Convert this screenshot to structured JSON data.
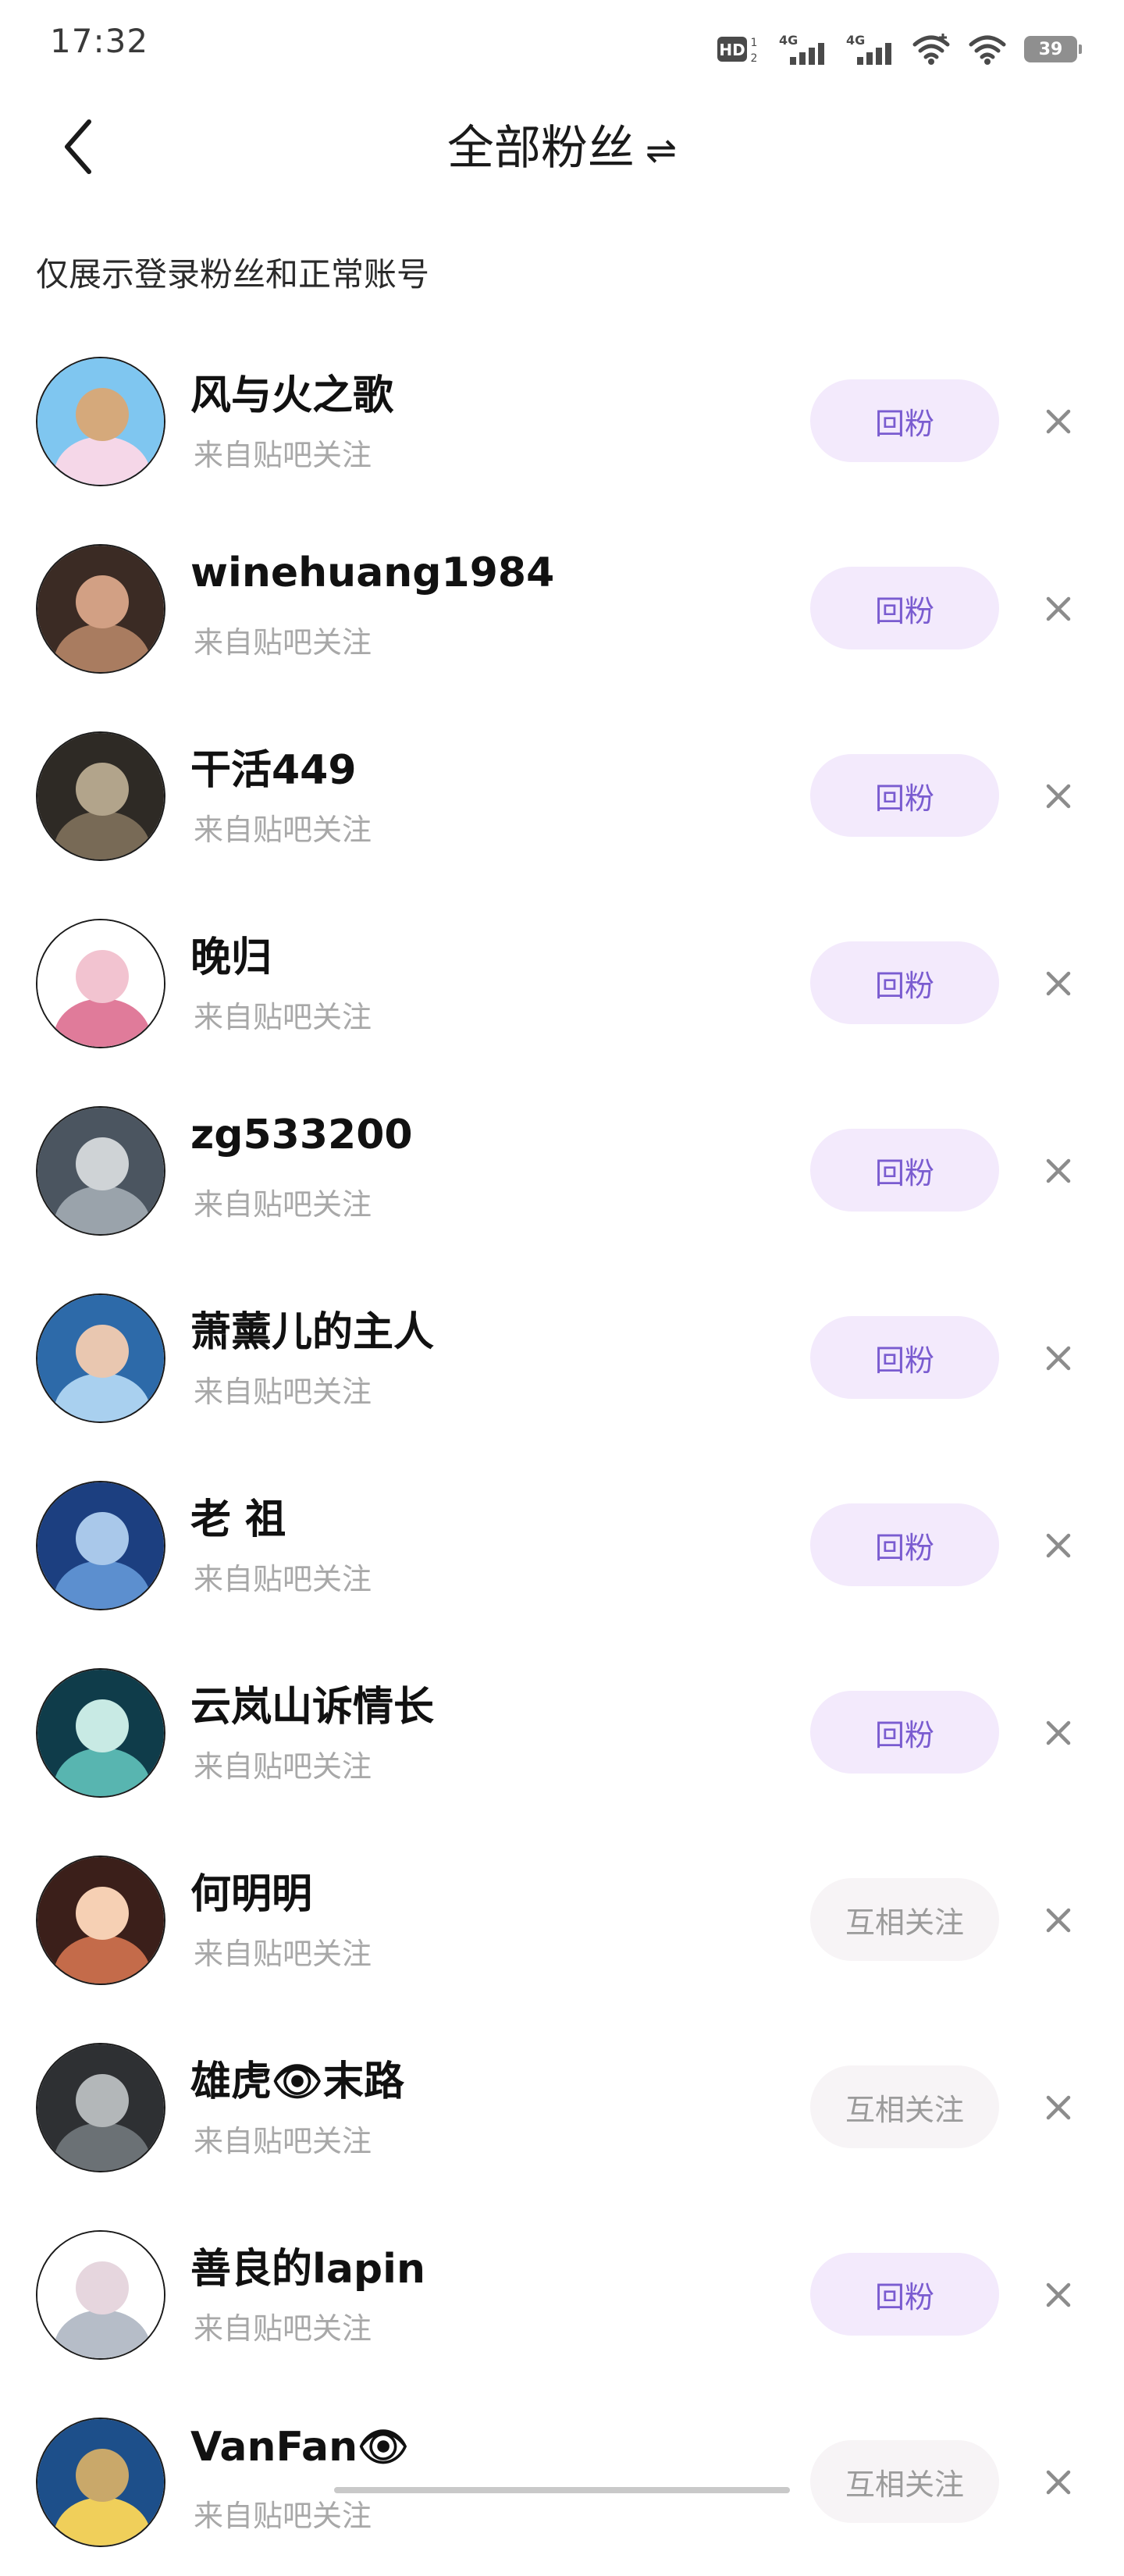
{
  "status_bar": {
    "time": "17:32",
    "battery": "39",
    "icons": [
      "hd-icon",
      "signal-4g-icon",
      "signal-4g-icon",
      "wifi-icon",
      "wifi-icon",
      "battery-icon"
    ]
  },
  "header": {
    "title": "全部粉丝",
    "swap_glyph": "⇌"
  },
  "notice": "仅展示登录粉丝和正常账号",
  "fans": [
    {
      "name": "风与火之歌",
      "source": "来自贴吧关注",
      "action": "回粉",
      "type": "follow-back",
      "avatar_colors": [
        "#7fc6f0",
        "#f5d7e8",
        "#d5a97b"
      ]
    },
    {
      "name": "winehuang1984",
      "source": "来自贴吧关注",
      "action": "回粉",
      "type": "follow-back",
      "avatar_colors": [
        "#3b2b24",
        "#a97c60",
        "#d2a084"
      ]
    },
    {
      "name": "干活449",
      "source": "来自贴吧关注",
      "action": "回粉",
      "type": "follow-back",
      "avatar_colors": [
        "#2e2a25",
        "#786a56",
        "#b2a48b"
      ]
    },
    {
      "name": "晚归",
      "source": "来自贴吧关注",
      "action": "回粉",
      "type": "follow-back",
      "avatar_colors": [
        "#ffffff",
        "#e07b9a",
        "#f2c3d0"
      ]
    },
    {
      "name": "zg533200",
      "source": "来自贴吧关注",
      "action": "回粉",
      "type": "follow-back",
      "avatar_colors": [
        "#4b5560",
        "#9aa3ab",
        "#cfd3d6"
      ]
    },
    {
      "name": "萧薰儿的主人",
      "source": "来自贴吧关注",
      "action": "回粉",
      "type": "follow-back",
      "avatar_colors": [
        "#2d6aa9",
        "#a9d0ef",
        "#e9c7b0"
      ]
    },
    {
      "name": "老 祖",
      "source": "来自贴吧关注",
      "action": "回粉",
      "type": "follow-back",
      "avatar_colors": [
        "#1c3f80",
        "#5c8fcf",
        "#a9c8ea"
      ]
    },
    {
      "name": "云岚山诉情长",
      "source": "来自贴吧关注",
      "action": "回粉",
      "type": "follow-back",
      "avatar_colors": [
        "#0f3c4a",
        "#58b5b0",
        "#c8eae4"
      ]
    },
    {
      "name": "何明明",
      "source": "来自贴吧关注",
      "action": "互相关注",
      "type": "mutual",
      "avatar_colors": [
        "#3b1f1a",
        "#c46b4a",
        "#f6d0b4"
      ]
    },
    {
      "name": "雄虎👁末路",
      "source": "来自贴吧关注",
      "action": "互相关注",
      "type": "mutual",
      "avatar_colors": [
        "#2e3033",
        "#6b7175",
        "#b3b7b9"
      ]
    },
    {
      "name": "善良的lapin",
      "source": "来自贴吧关注",
      "action": "回粉",
      "type": "follow-back",
      "avatar_colors": [
        "#ffffff",
        "#b6bdc8",
        "#e6d6de"
      ]
    },
    {
      "name": "VanFan👁",
      "source": "来自贴吧关注",
      "action": "互相关注",
      "type": "mutual",
      "avatar_colors": [
        "#1d4f8a",
        "#f0cf5a",
        "#c9a86a"
      ]
    }
  ]
}
